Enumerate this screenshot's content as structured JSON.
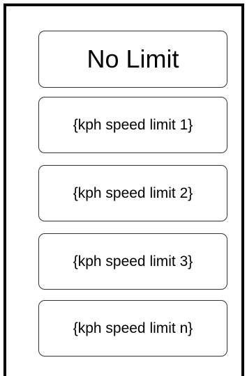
{
  "speed_limit_menu": {
    "no_limit_label": "No Limit",
    "options": [
      {
        "label": "{kph speed limit 1}"
      },
      {
        "label": "{kph speed limit 2}"
      },
      {
        "label": "{kph speed limit 3}"
      },
      {
        "label": "{kph speed limit n}"
      }
    ]
  }
}
